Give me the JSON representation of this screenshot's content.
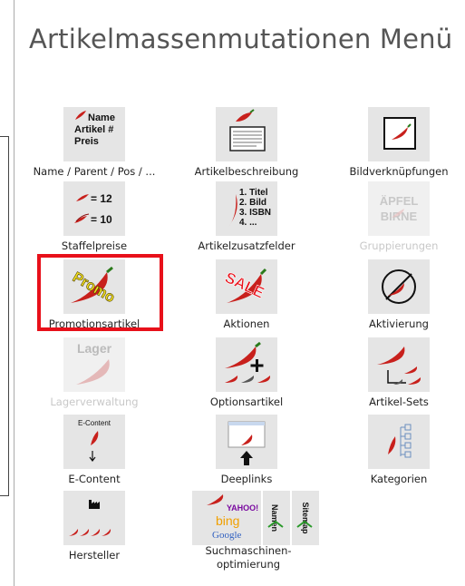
{
  "title": "Artikelmassenmutationen Menü",
  "accent_color": "#e8101a",
  "tiles": [
    {
      "label": "Name / Parent / Pos / ...",
      "icon": "name-article-icon",
      "icon_text": [
        "Name",
        "Artikel #",
        "Preis"
      ]
    },
    {
      "label": "Artikelbeschreibung",
      "icon": "article-description-icon"
    },
    {
      "label": "Bildverknüpfungen",
      "icon": "image-link-icon"
    },
    {
      "label": "Staffelpreise",
      "icon": "tiered-prices-icon",
      "icon_text": [
        "= 12",
        "= 10"
      ]
    },
    {
      "label": "Artikelzusatzfelder",
      "icon": "additional-fields-icon",
      "icon_text": [
        "1. Titel",
        "2. Bild",
        "3. ISBN",
        "4. ..."
      ]
    },
    {
      "label": "Gruppierungen",
      "icon": "grouping-icon",
      "disabled": true,
      "icon_text": [
        "ÄPFEL",
        "BIRNE"
      ]
    },
    {
      "label": "Promotionsartikel",
      "icon": "promo-icon",
      "selected": true,
      "icon_text": [
        "Promo"
      ]
    },
    {
      "label": "Aktionen",
      "icon": "sale-icon",
      "icon_text": [
        "SALE"
      ]
    },
    {
      "label": "Aktivierung",
      "icon": "activation-icon"
    },
    {
      "label": "Lagerverwaltung",
      "icon": "warehouse-icon",
      "disabled": true,
      "icon_text": [
        "Lager"
      ]
    },
    {
      "label": "Optionsartikel",
      "icon": "option-article-icon"
    },
    {
      "label": "Artikel-Sets",
      "icon": "article-sets-icon"
    },
    {
      "label": "E-Content",
      "icon": "e-content-icon",
      "icon_text": [
        "E-Content"
      ]
    },
    {
      "label": "Deeplinks",
      "icon": "deeplinks-icon"
    },
    {
      "label": "Kategorien",
      "icon": "categories-icon"
    },
    {
      "label": "Hersteller",
      "icon": "manufacturer-icon"
    },
    {
      "label": "Suchmaschinen-optimierung",
      "icon": "seo-icon",
      "icon_text": [
        "YAHOO!",
        "bing",
        "Google",
        "Namen",
        "Sitemap"
      ]
    }
  ]
}
